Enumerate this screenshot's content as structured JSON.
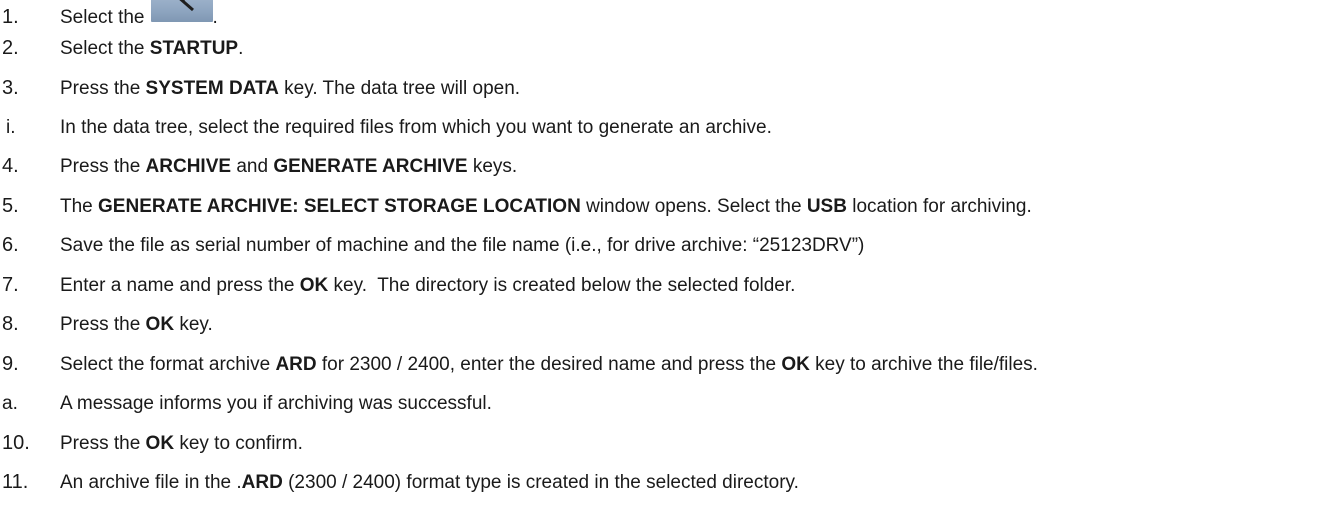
{
  "steps": [
    {
      "num": "1.",
      "parts": [
        "Select the "
      ],
      "icon": "wrench-icon",
      "after_icon": "."
    },
    {
      "num": "2.",
      "parts": [
        "Select the ",
        "STARTUP",
        "."
      ]
    },
    {
      "num": "3.",
      "parts": [
        "Press the ",
        "SYSTEM DATA",
        " key. The data tree will open."
      ]
    },
    {
      "num": "i.",
      "parts": [
        "In the data tree, select the required files from which you want to generate an archive."
      ]
    },
    {
      "num": "4.",
      "parts": [
        "Press the ",
        "ARCHIVE",
        " and ",
        "GENERATE ARCHIVE",
        " keys."
      ]
    },
    {
      "num": "5.",
      "parts": [
        "The ",
        "GENERATE ARCHIVE: SELECT STORAGE LOCATION",
        " window opens. Select the ",
        "USB",
        " location for archiving."
      ]
    },
    {
      "num": "6.",
      "parts": [
        "Save the file as serial number of machine and the file name (i.e., for drive archive: “25123DRV”)"
      ]
    },
    {
      "num": "7.",
      "parts": [
        "Enter a name and press the ",
        "OK",
        " key.  The directory is created below the selected folder."
      ]
    },
    {
      "num": "8.",
      "parts": [
        "Press the ",
        "OK",
        " key."
      ]
    },
    {
      "num": "9.",
      "parts": [
        "Select the format archive ",
        "ARD",
        " for 2300 / 2400, enter the desired name and press the ",
        "OK",
        " key to archive the file/files."
      ]
    },
    {
      "num": "a.",
      "parts": [
        "A message informs you if archiving was successful."
      ]
    },
    {
      "num": "10.",
      "parts": [
        "Press the ",
        "OK",
        " key to confirm."
      ]
    },
    {
      "num": "11.",
      "parts": [
        "An archive file in the .",
        "ARD",
        " (2300 / 2400) format type is created in the selected directory."
      ]
    }
  ],
  "colors": {
    "text": "#1a1a1a",
    "icon_bg": "#8da4bf"
  }
}
